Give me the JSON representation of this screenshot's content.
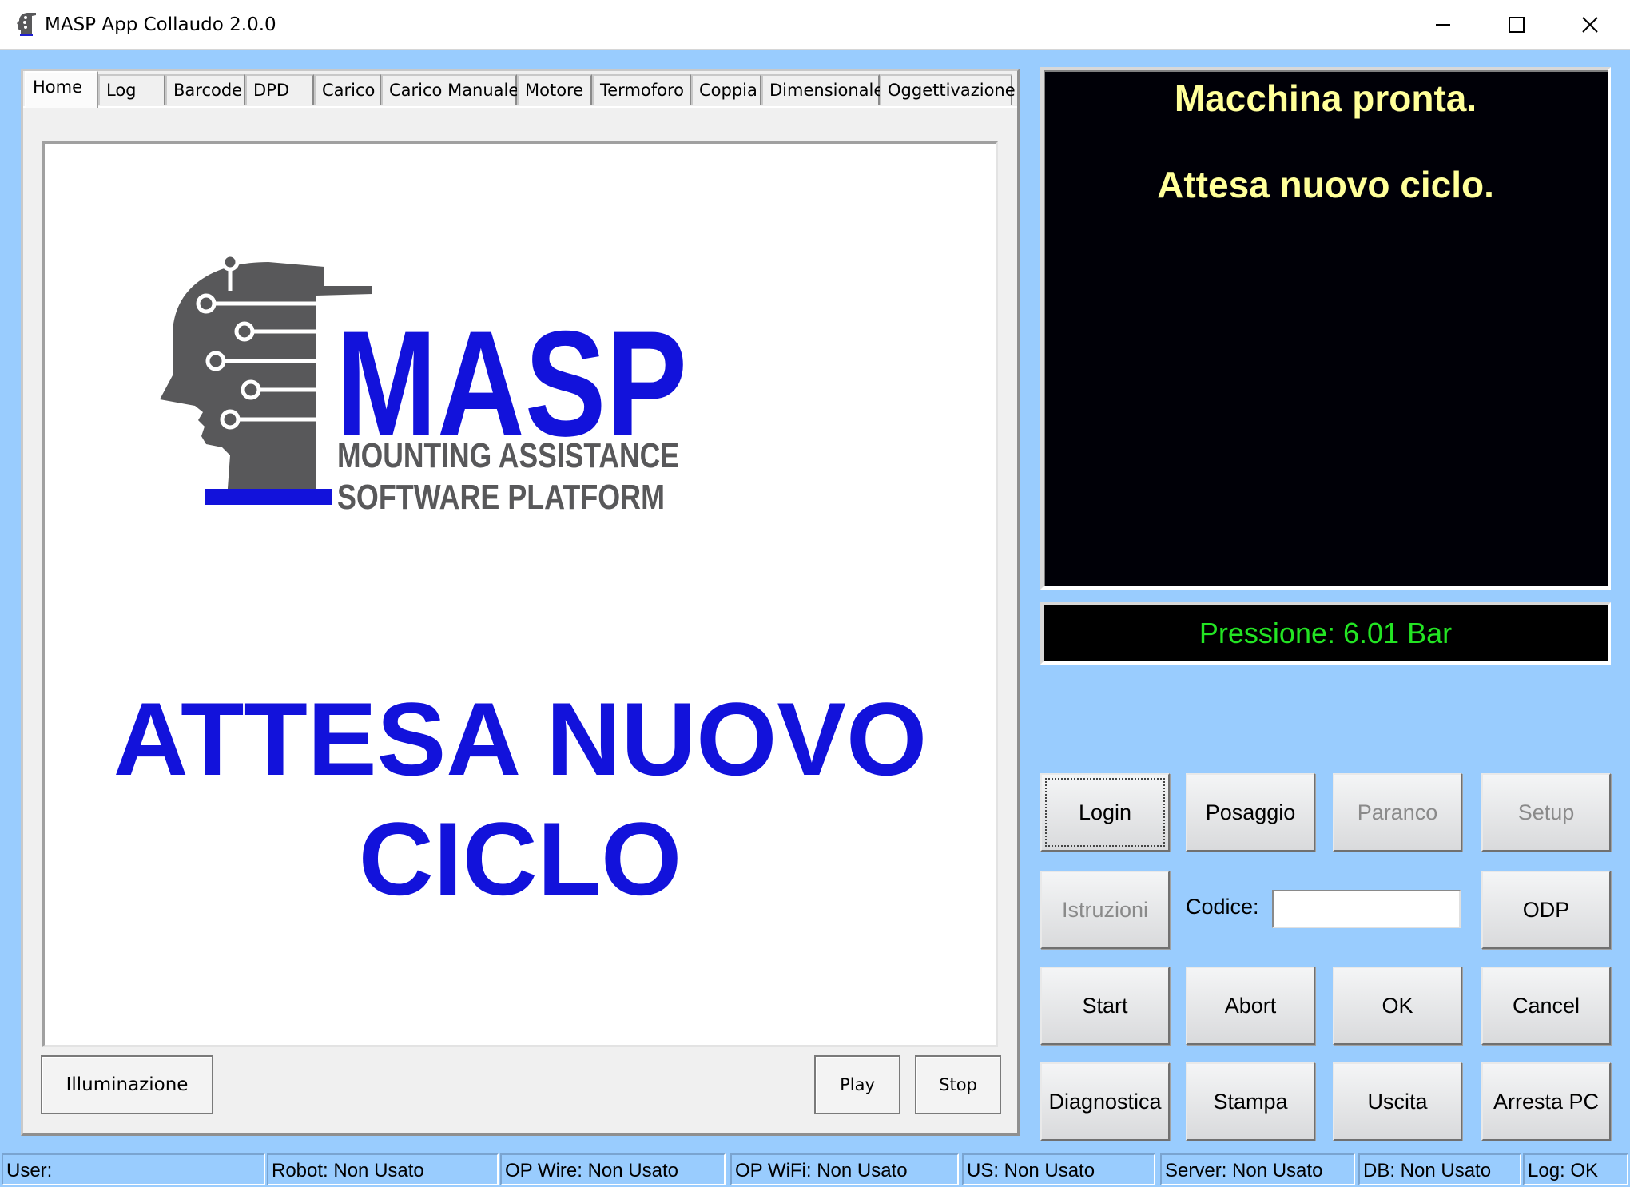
{
  "window": {
    "title": "MASP App Collaudo 2.0.0",
    "controls": {
      "minimize_icon": "minimize-icon",
      "maximize_icon": "maximize-icon",
      "close_icon": "close-icon"
    }
  },
  "tabs": [
    {
      "label": "Home",
      "active": true
    },
    {
      "label": "Log"
    },
    {
      "label": "Barcode"
    },
    {
      "label": "DPD"
    },
    {
      "label": "Carico"
    },
    {
      "label": "Carico Manuale"
    },
    {
      "label": "Motore"
    },
    {
      "label": "Termoforo"
    },
    {
      "label": "Coppia"
    },
    {
      "label": "Dimensionale"
    },
    {
      "label": "Oggettivazione"
    }
  ],
  "home": {
    "logo": {
      "word": "MASP",
      "line1": "MOUNTING ASSISTANCE",
      "line2": "SOFTWARE PLATFORM"
    },
    "status_line1": "ATTESA NUOVO",
    "status_line2": "CICLO",
    "illumination_label": "Illuminazione",
    "play_label": "Play",
    "stop_label": "Stop"
  },
  "messages": {
    "line1": "Macchina pronta.",
    "line2": "Attesa nuovo ciclo."
  },
  "pressure": "Pressione: 6.01 Bar",
  "buttons": {
    "login": "Login",
    "posaggio": "Posaggio",
    "paranco": "Paranco",
    "setup": "Setup",
    "istruzioni": "Istruzioni",
    "codice_label": "Codice:",
    "codice_value": "",
    "odp": "ODP",
    "start": "Start",
    "abort": "Abort",
    "ok": "OK",
    "cancel": "Cancel",
    "diagnostica": "Diagnostica",
    "stampa": "Stampa",
    "uscita": "Uscita",
    "arresta": "Arresta PC"
  },
  "status_bar": [
    "User:",
    "Robot: Non Usato",
    "OP Wire: Non Usato",
    "OP WiFi: Non Usato",
    "US: Non Usato",
    "Server: Non Usato",
    "DB: Non Usato",
    "Log: OK"
  ],
  "colors": {
    "background": "#99ccfe",
    "accent_blue": "#1212db",
    "message_text": "#ffff99",
    "pressure_text": "#23e523",
    "logo_gray": "#58585a"
  }
}
